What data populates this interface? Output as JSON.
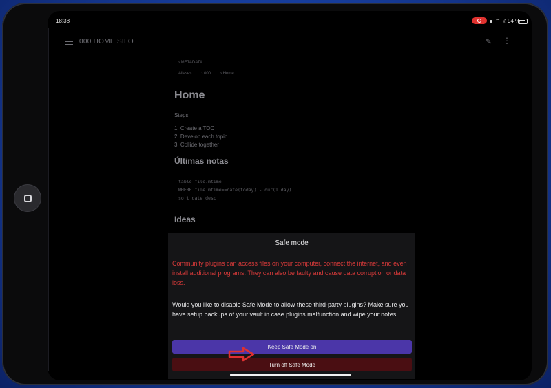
{
  "status": {
    "time": "18:38",
    "battery": "94 %"
  },
  "topbar": {
    "title": "000 HOME SILO"
  },
  "note": {
    "metadata": "› METADATA",
    "props": [
      "Aliases",
      "› 000",
      "› Home"
    ],
    "heading": "Home",
    "steps_label": "Steps:",
    "steps": [
      "1.  Create a TOC",
      "2.  Develop each topic",
      "3.  Collide together"
    ],
    "latest_heading": "Últimas notas",
    "code": [
      "table file.mtime",
      "WHERE file.mtime>=date(today) - dur(1 day)",
      "sort date desc"
    ],
    "ideas_heading": "Ideas"
  },
  "modal": {
    "title": "Safe mode",
    "warning": "Community plugins can access files on your computer, connect the internet, and even install additional programs. They can also be faulty and cause data corruption or data loss.",
    "question": "Would you like to disable Safe Mode to allow these third-party plugins? Make sure you have setup backups of your vault in case plugins malfunction and wipe your notes.",
    "keep_label": "Keep Safe Mode on",
    "off_label": "Turn off Safe Mode"
  },
  "colors": {
    "keep_button": "#4b36a8",
    "off_button": "#4a0e12",
    "warning": "#d93a3a",
    "arrow": "#e03030"
  },
  "icons": [
    "menu-icon",
    "edit-icon",
    "more-icon",
    "record-icon",
    "wifi-icon",
    "moon-icon",
    "battery-icon",
    "home-button-icon",
    "arrow-icon"
  ]
}
